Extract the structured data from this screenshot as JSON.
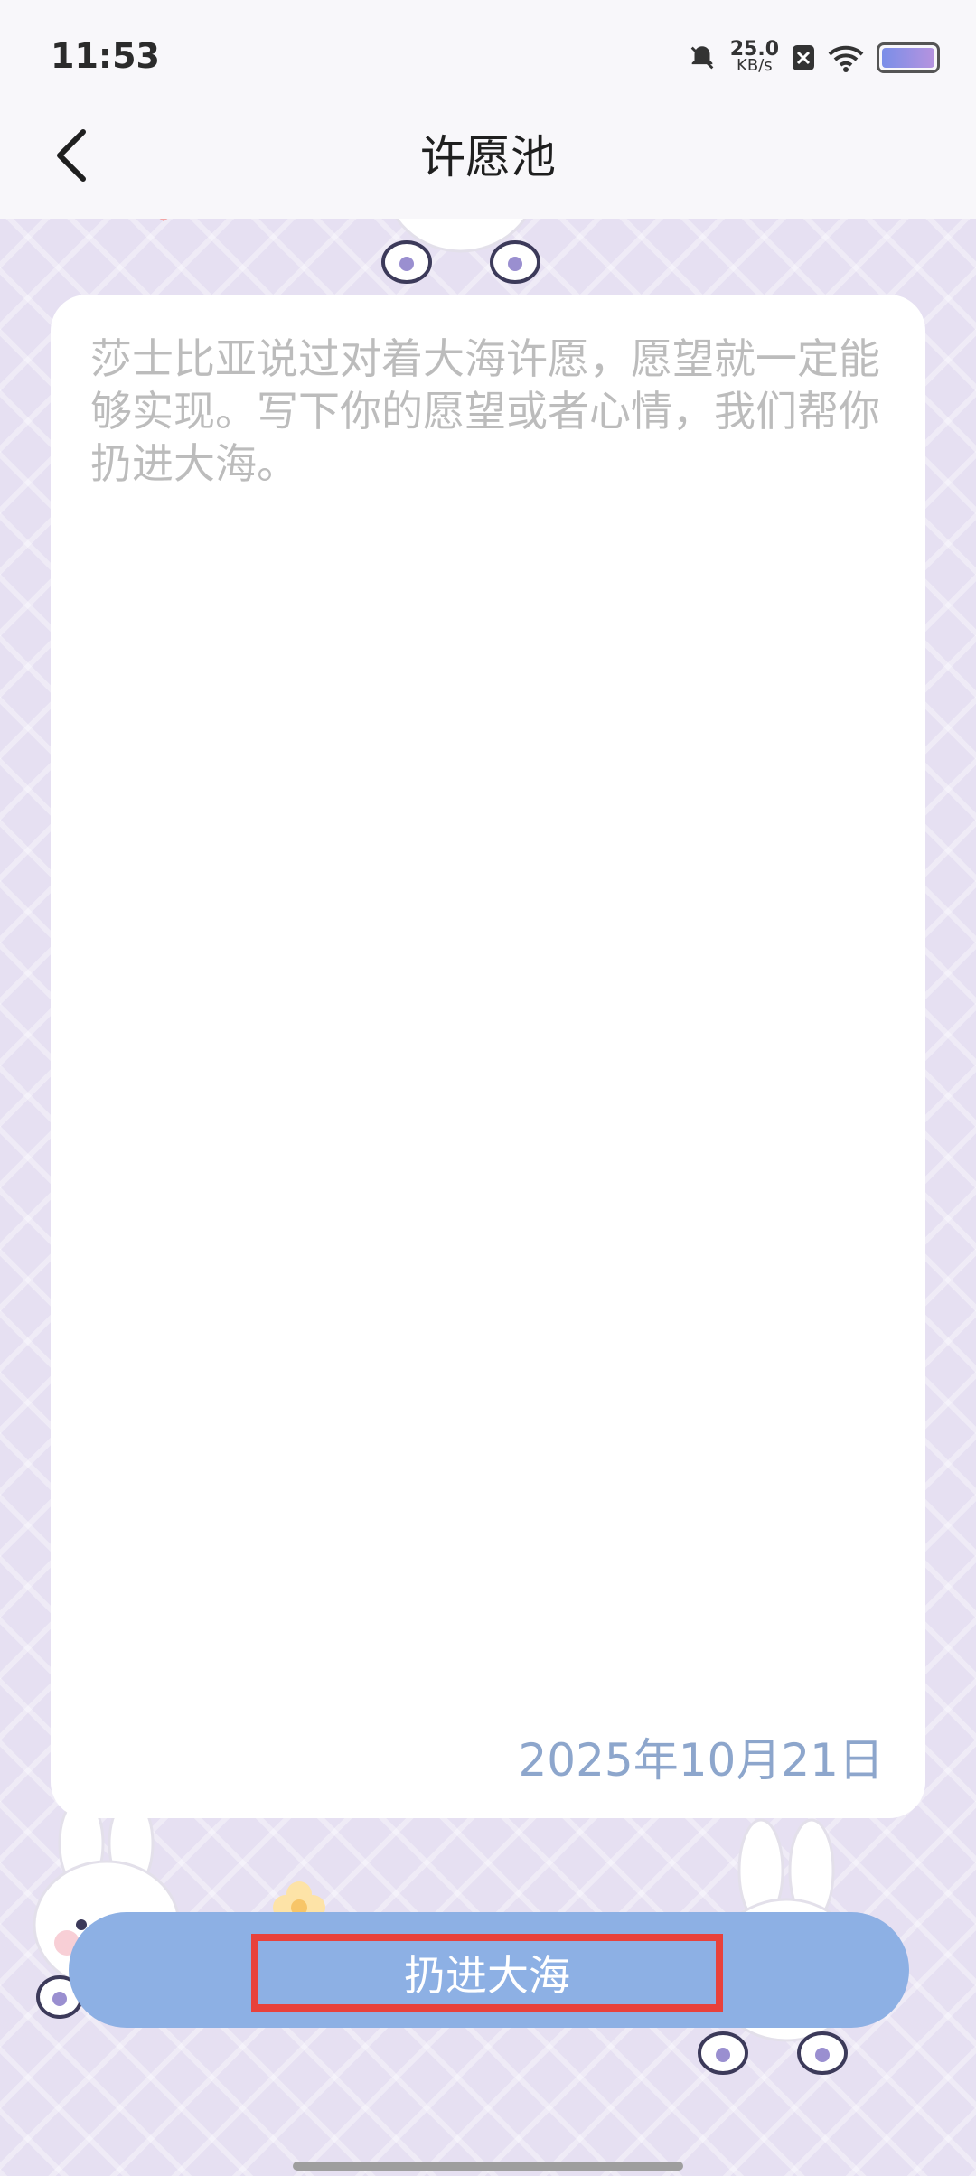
{
  "status_bar": {
    "time": "11:53",
    "network_speed": "25.0",
    "network_unit": "KB/s"
  },
  "header": {
    "title": "许愿池",
    "back_icon": "chevron-left-icon"
  },
  "wish_card": {
    "placeholder": "莎士比亚说过对着大海许愿，愿望就一定能够实现。写下你的愿望或者心情，我们帮你扔进大海。",
    "date": "2025年10月21日"
  },
  "action": {
    "label": "扔进大海"
  },
  "colors": {
    "accent": "#8db0e4",
    "date_text": "#8da6cc",
    "highlight_border": "#e8413b"
  }
}
